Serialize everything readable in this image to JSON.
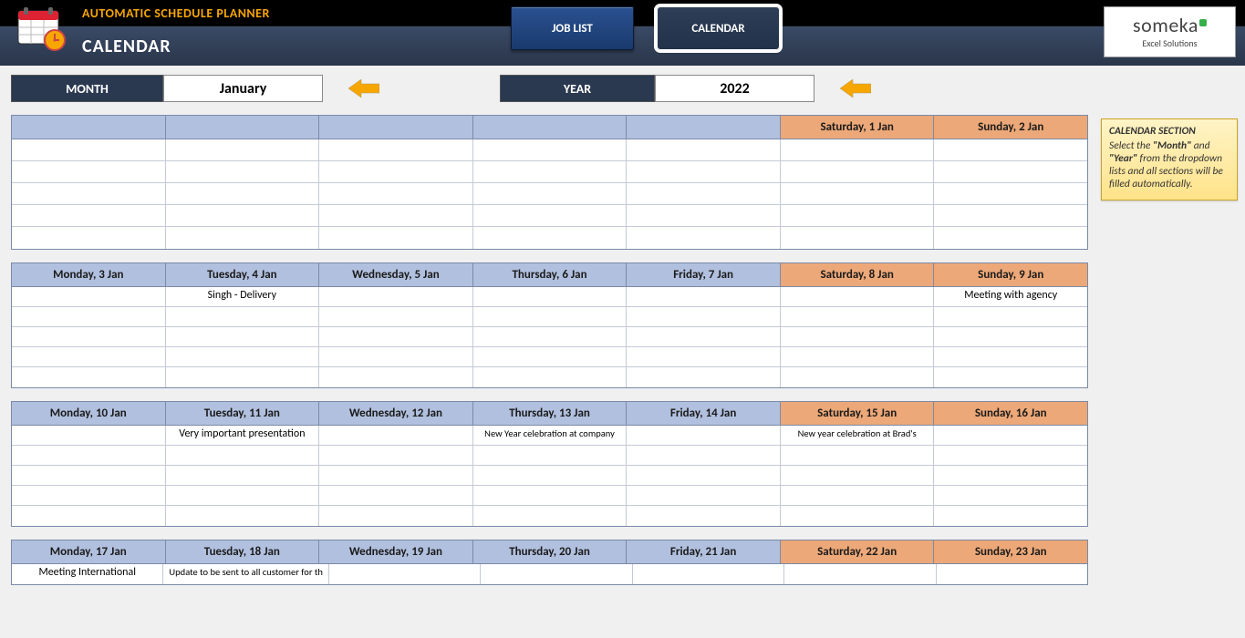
{
  "app": {
    "title": "AUTOMATIC SCHEDULE PLANNER"
  },
  "header": {
    "title": "CALENDAR",
    "tabs": {
      "job_list": "JOB LIST",
      "calendar": "CALENDAR"
    }
  },
  "brand": {
    "name": "someka",
    "sub": "Excel Solutions"
  },
  "controls": {
    "month_label": "MONTH",
    "month_value": "January",
    "year_label": "YEAR",
    "year_value": "2022"
  },
  "note": {
    "title": "CALENDAR SECTION",
    "l1": "Select the ",
    "b1": "\"Month\"",
    "l2": " and ",
    "b2": "\"Year\"",
    "l3": " from the dropdown lists and all sections will be filled automatically."
  },
  "weeks": [
    {
      "days": [
        {
          "label": "",
          "weekend": false,
          "events": [
            "",
            "",
            "",
            "",
            ""
          ]
        },
        {
          "label": "",
          "weekend": false,
          "events": [
            "",
            "",
            "",
            "",
            ""
          ]
        },
        {
          "label": "",
          "weekend": false,
          "events": [
            "",
            "",
            "",
            "",
            ""
          ]
        },
        {
          "label": "",
          "weekend": false,
          "events": [
            "",
            "",
            "",
            "",
            ""
          ]
        },
        {
          "label": "",
          "weekend": false,
          "events": [
            "",
            "",
            "",
            "",
            ""
          ]
        },
        {
          "label": "Saturday, 1 Jan",
          "weekend": true,
          "events": [
            "",
            "",
            "",
            "",
            ""
          ]
        },
        {
          "label": "Sunday, 2 Jan",
          "weekend": true,
          "events": [
            "",
            "",
            "",
            "",
            ""
          ]
        }
      ]
    },
    {
      "days": [
        {
          "label": "Monday, 3 Jan",
          "weekend": false,
          "events": [
            "",
            "",
            "",
            "",
            ""
          ]
        },
        {
          "label": "Tuesday, 4 Jan",
          "weekend": false,
          "events": [
            "Singh - Delivery",
            "",
            "",
            "",
            ""
          ]
        },
        {
          "label": "Wednesday, 5 Jan",
          "weekend": false,
          "events": [
            "",
            "",
            "",
            "",
            ""
          ]
        },
        {
          "label": "Thursday, 6 Jan",
          "weekend": false,
          "events": [
            "",
            "",
            "",
            "",
            ""
          ]
        },
        {
          "label": "Friday, 7 Jan",
          "weekend": false,
          "events": [
            "",
            "",
            "",
            "",
            ""
          ]
        },
        {
          "label": "Saturday, 8 Jan",
          "weekend": true,
          "events": [
            "",
            "",
            "",
            "",
            ""
          ]
        },
        {
          "label": "Sunday, 9 Jan",
          "weekend": true,
          "events": [
            "Meeting with agency",
            "",
            "",
            "",
            ""
          ]
        }
      ]
    },
    {
      "days": [
        {
          "label": "Monday, 10 Jan",
          "weekend": false,
          "events": [
            "",
            "",
            "",
            "",
            ""
          ]
        },
        {
          "label": "Tuesday, 11 Jan",
          "weekend": false,
          "events": [
            "Very important presentation",
            "",
            "",
            "",
            ""
          ]
        },
        {
          "label": "Wednesday, 12 Jan",
          "weekend": false,
          "events": [
            "",
            "",
            "",
            "",
            ""
          ]
        },
        {
          "label": "Thursday, 13 Jan",
          "weekend": false,
          "events": [
            "New Year celebration at company",
            "",
            "",
            "",
            ""
          ]
        },
        {
          "label": "Friday, 14 Jan",
          "weekend": false,
          "events": [
            "",
            "",
            "",
            "",
            ""
          ]
        },
        {
          "label": "Saturday, 15 Jan",
          "weekend": true,
          "events": [
            "New year celebration at Brad's",
            "",
            "",
            "",
            ""
          ]
        },
        {
          "label": "Sunday, 16 Jan",
          "weekend": true,
          "events": [
            "",
            "",
            "",
            "",
            ""
          ]
        }
      ]
    },
    {
      "days": [
        {
          "label": "Monday, 17 Jan",
          "weekend": false,
          "events": [
            "Meeting International"
          ]
        },
        {
          "label": "Tuesday, 18 Jan",
          "weekend": false,
          "events": [
            "Update to be sent to all customer for th"
          ]
        },
        {
          "label": "Wednesday, 19 Jan",
          "weekend": false,
          "events": [
            ""
          ]
        },
        {
          "label": "Thursday, 20 Jan",
          "weekend": false,
          "events": [
            ""
          ]
        },
        {
          "label": "Friday, 21 Jan",
          "weekend": false,
          "events": [
            ""
          ]
        },
        {
          "label": "Saturday, 22 Jan",
          "weekend": true,
          "events": [
            ""
          ]
        },
        {
          "label": "Sunday, 23 Jan",
          "weekend": true,
          "events": [
            ""
          ]
        }
      ]
    }
  ]
}
